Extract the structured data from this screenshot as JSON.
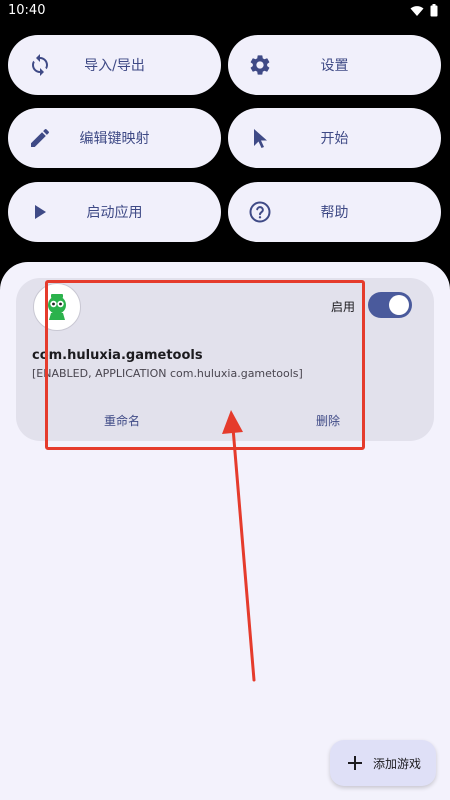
{
  "status_bar": {
    "time": "10:40"
  },
  "toolbar": {
    "import_export": "导入/导出",
    "settings": "设置",
    "edit_keymap": "编辑键映射",
    "start": "开始",
    "launch_app": "启动应用",
    "help": "帮助"
  },
  "app_card": {
    "enable_label": "启用",
    "enabled": true,
    "package_name": "com.huluxia.gametools",
    "description": "[ENABLED, APPLICATION com.huluxia.gametools]",
    "rename": "重命名",
    "delete": "删除"
  },
  "fab": {
    "label": "添加游戏"
  },
  "colors": {
    "accent": "#3f4a86",
    "toggle": "#4a5a9c",
    "annotation": "#e53b2c"
  }
}
